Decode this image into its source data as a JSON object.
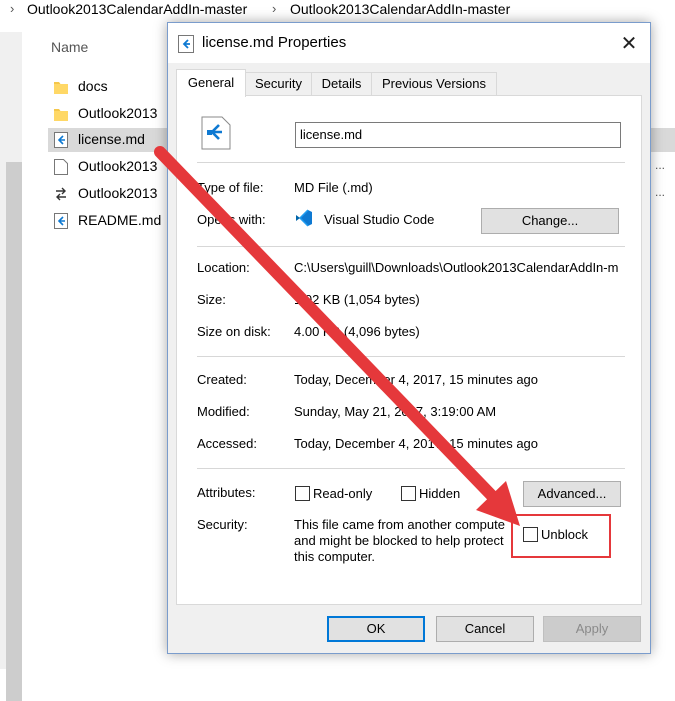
{
  "breadcrumb": [
    "Outlook2013CalendarAddIn-master",
    "Outlook2013CalendarAddIn-master"
  ],
  "explorer": {
    "column_name": "Name",
    "files": [
      {
        "name": "docs",
        "icon": "folder-icon"
      },
      {
        "name": "Outlook2013",
        "icon": "folder-icon"
      },
      {
        "name": "license.md",
        "icon": "vscode-file-icon"
      },
      {
        "name": "Outlook2013",
        "icon": "document-icon"
      },
      {
        "name": "Outlook2013",
        "icon": "shortcut-icon"
      },
      {
        "name": "README.md",
        "icon": "vscode-file-icon"
      }
    ]
  },
  "dialog": {
    "title": "license.md Properties",
    "tabs": [
      "General",
      "Security",
      "Details",
      "Previous Versions"
    ],
    "filename": "license.md",
    "type_label": "Type of file:",
    "type_value": "MD File (.md)",
    "opens_label": "Opens with:",
    "opens_value": "Visual Studio Code",
    "change_button": "Change...",
    "location_label": "Location:",
    "location_value": "C:\\Users\\guill\\Downloads\\Outlook2013CalendarAddIn-m",
    "size_label": "Size:",
    "size_value": "1.02 KB (1,054 bytes)",
    "size_disk_label": "Size on disk:",
    "size_disk_value": "4.00 KB (4,096 bytes)",
    "created_label": "Created:",
    "created_value": "Today, December 4, 2017, 15 minutes ago",
    "modified_label": "Modified:",
    "modified_value": "Sunday, May 21, 2017, 3:19:00 AM",
    "accessed_label": "Accessed:",
    "accessed_value": "Today, December 4, 2017, 15 minutes ago",
    "attributes_label": "Attributes:",
    "readonly_label": "Read-only",
    "hidden_label": "Hidden",
    "advanced_button": "Advanced...",
    "security_label": "Security:",
    "security_line1": "This file came from another compute",
    "security_line2": "and might be blocked to help protect",
    "security_line3": "this computer.",
    "unblock_label": "Unblock",
    "ok_button": "OK",
    "cancel_button": "Cancel",
    "apply_button": "Apply"
  },
  "colors": {
    "accent": "#0078d7",
    "annotation_arrow": "#e5383b",
    "vscode_blue": "#0e79d2"
  }
}
